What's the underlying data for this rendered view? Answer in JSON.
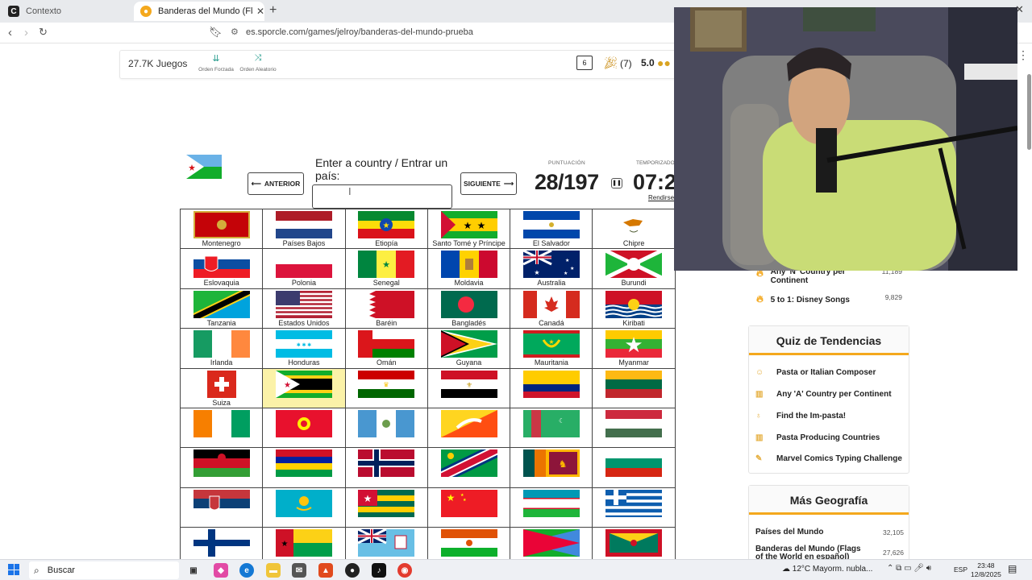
{
  "browser": {
    "tabs": [
      {
        "title": "Contexto",
        "active": false
      },
      {
        "title": "Banderas del Mundo (Flags of the World en español)",
        "active": true
      }
    ],
    "url": "es.sporcle.com/games/jelroy/banderas-del-mundo-prueba"
  },
  "toolbar": {
    "games_count": "27.7K Juegos",
    "forced_order": "Orden Forzada",
    "random_order": "Orden Aleatorio",
    "comments": "6",
    "party_count": "(7)",
    "rating": "5.0"
  },
  "game": {
    "prompt": "Enter a country / Entrar un país:",
    "prev_label": "ANTERIOR",
    "next_label": "SIGUIENTE",
    "score_label": "PUNTUACIÓN",
    "score": "28/197",
    "timer_label": "TEMPORIZADO",
    "timer": "07:2",
    "give_up": "Rendirse"
  },
  "flags": [
    [
      "Montenegro",
      "Países Bajos",
      "Etiopía",
      "Santo Tomé y Príncipe",
      "El Salvador",
      "Chipre"
    ],
    [
      "Eslovaquia",
      "Polonia",
      "Senegal",
      "Moldavia",
      "Australia",
      "Burundi"
    ],
    [
      "Tanzania",
      "Estados Unidos",
      "Baréin",
      "Bangladés",
      "Canadá",
      "Kiribati"
    ],
    [
      "Irlanda",
      "Honduras",
      "Omán",
      "Guyana",
      "Mauritania",
      "Myanmar"
    ],
    [
      "Suiza",
      "",
      "",
      "",
      "",
      ""
    ],
    [
      "",
      "",
      "",
      "",
      "",
      ""
    ],
    [
      "",
      "",
      "",
      "",
      "",
      ""
    ],
    [
      "",
      "",
      "",
      "",
      "",
      ""
    ],
    [
      "",
      "",
      "",
      "",
      "",
      ""
    ]
  ],
  "sidebar": {
    "top_items": [
      {
        "label": "Any 'N' Country per Continent",
        "count": "11,189"
      },
      {
        "label": "5 to 1: Disney Songs",
        "count": "9,829"
      }
    ],
    "trending_title": "Quiz de Tendencias",
    "trending": [
      "Pasta or Italian Composer",
      "Any 'A' Country per Continent",
      "Find the Im-pasta!",
      "Pasta Producing Countries",
      "Marvel Comics Typing Challenge"
    ],
    "geo_title": "Más Geografía",
    "geo": [
      {
        "label": "Países del Mundo",
        "count": "32,105"
      },
      {
        "label": "Banderas del Mundo (Flags of the World en español)",
        "count": "27,626"
      }
    ]
  },
  "taskbar": {
    "search": "Buscar",
    "weather": "12°C  Mayorm. nubla...",
    "lang": "ESP",
    "time": "23:48",
    "date": "12/8/2025"
  }
}
